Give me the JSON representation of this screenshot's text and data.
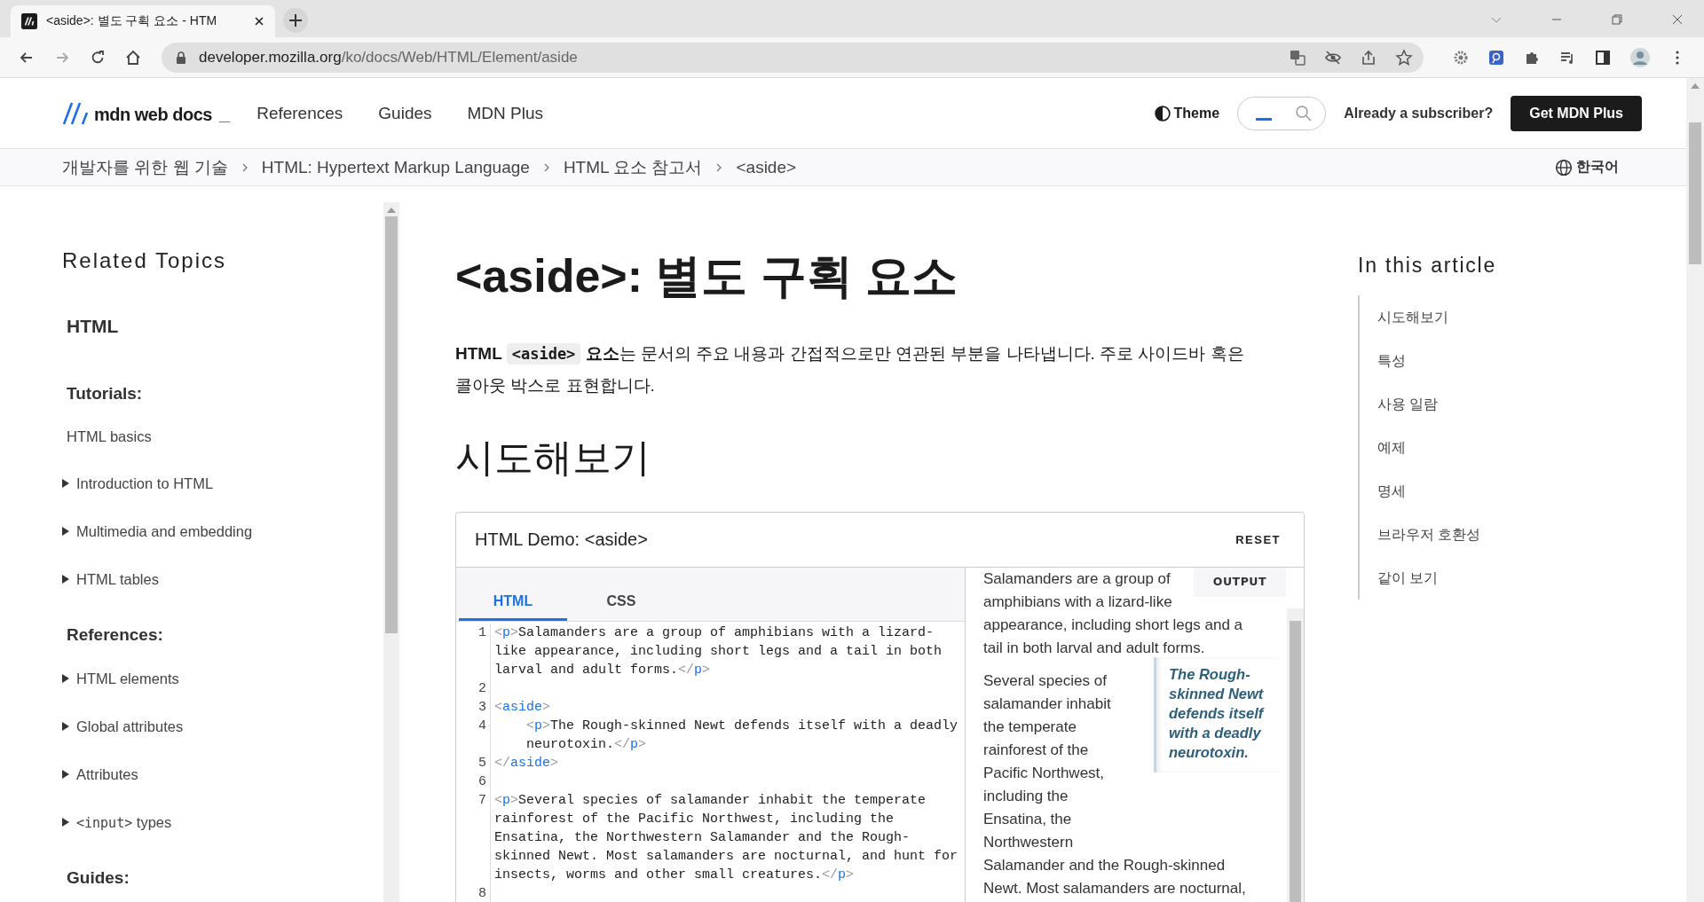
{
  "browser": {
    "tab": {
      "title": "<aside>: 별도 구획 요소 - HTM"
    },
    "address": {
      "host": "developer.mozilla.org",
      "path": "/ko/docs/Web/HTML/Element/aside"
    }
  },
  "header": {
    "logo": "mdn web docs",
    "logo_mark": "_",
    "nav": [
      "References",
      "Guides",
      "MDN Plus"
    ],
    "theme": "Theme",
    "subscriber": "Already a subscriber?",
    "cta": "Get MDN Plus"
  },
  "breadcrumbs": [
    "개발자를 위한 웹 기술",
    "HTML: Hypertext Markup Language",
    "HTML 요소 참고서",
    "<aside>"
  ],
  "language": "한국어",
  "sidebar": {
    "title": "Related Topics",
    "items": [
      {
        "kind": "section",
        "label": "HTML"
      },
      {
        "kind": "heading",
        "label": "Tutorials:"
      },
      {
        "kind": "link",
        "label": "HTML basics"
      },
      {
        "kind": "toggle",
        "label": "Introduction to HTML",
        "expanded": false
      },
      {
        "kind": "toggle",
        "label": "Multimedia and embedding",
        "expanded": false
      },
      {
        "kind": "toggle",
        "label": "HTML tables",
        "expanded": false
      },
      {
        "kind": "heading",
        "label": "References:"
      },
      {
        "kind": "toggle",
        "label": "HTML elements",
        "expanded": false
      },
      {
        "kind": "toggle",
        "label": "Global attributes",
        "expanded": false
      },
      {
        "kind": "toggle",
        "label": "Attributes",
        "expanded": false
      },
      {
        "kind": "toggle",
        "code": "<input>",
        "label": "types",
        "expanded": false
      },
      {
        "kind": "heading",
        "label": "Guides:"
      }
    ]
  },
  "article": {
    "title": "<aside>: 별도 구획 요소",
    "intro": [
      {
        "kind": "strong",
        "text": "HTML "
      },
      {
        "kind": "code",
        "text": "<aside>"
      },
      {
        "kind": "strong",
        "text": " 요소"
      },
      {
        "kind": "plain",
        "text": "는 문서의 주요 내용과 간접적으로만 연관된 부분을 나타냅니다. 주로 사이드바 혹은 콜아웃 박스로 표현합니다."
      }
    ],
    "section_title": "시도해보기"
  },
  "demo": {
    "title": "HTML Demo: <aside>",
    "reset": "RESET",
    "tabs": [
      {
        "label": "HTML",
        "selected": true
      },
      {
        "label": "CSS",
        "selected": false
      }
    ],
    "code_lines": [
      {
        "number": "1",
        "parts": [
          {
            "kind": "punct",
            "text": "<"
          },
          {
            "kind": "tag",
            "text": "p"
          },
          {
            "kind": "punct",
            "text": ">"
          },
          {
            "kind": "text",
            "text": "Salamanders are a group of amphibians with a lizard-like appearance, including short legs and a tail in both larval and adult forms."
          },
          {
            "kind": "punct",
            "text": "</"
          },
          {
            "kind": "tag",
            "text": "p"
          },
          {
            "kind": "punct",
            "text": ">"
          }
        ]
      },
      {
        "number": "2"
      },
      {
        "number": "3",
        "parts": [
          {
            "kind": "punct",
            "text": "<"
          },
          {
            "kind": "tag",
            "text": "aside"
          },
          {
            "kind": "punct",
            "text": ">"
          }
        ]
      },
      {
        "number": "4",
        "indent": true,
        "parts": [
          {
            "kind": "punct",
            "text": "<"
          },
          {
            "kind": "tag",
            "text": "p"
          },
          {
            "kind": "punct",
            "text": ">"
          },
          {
            "kind": "text",
            "text": "The Rough-skinned Newt defends itself with a deadly neurotoxin."
          },
          {
            "kind": "punct",
            "text": "</"
          },
          {
            "kind": "tag",
            "text": "p"
          },
          {
            "kind": "punct",
            "text": ">"
          }
        ]
      },
      {
        "number": "5",
        "parts": [
          {
            "kind": "punct",
            "text": "</"
          },
          {
            "kind": "tag",
            "text": "aside"
          },
          {
            "kind": "punct",
            "text": ">"
          }
        ]
      },
      {
        "number": "6"
      },
      {
        "number": "7",
        "parts": [
          {
            "kind": "punct",
            "text": "<"
          },
          {
            "kind": "tag",
            "text": "p"
          },
          {
            "kind": "punct",
            "text": ">"
          },
          {
            "kind": "text",
            "text": "Several species of salamander inhabit the temperate rainforest of the Pacific Northwest, including the Ensatina, the Northwestern Salamander and the Rough-skinned Newt. Most salamanders are nocturnal, and hunt for insects, worms and other small creatures."
          },
          {
            "kind": "punct",
            "text": "</"
          },
          {
            "kind": "tag",
            "text": "p"
          },
          {
            "kind": "punct",
            "text": ">"
          }
        ]
      },
      {
        "number": "8"
      }
    ],
    "output_label": "OUTPUT",
    "output": {
      "first": [
        "Salamanders are a group of",
        "amphibians with a lizard-like",
        "appearance, including short legs and a",
        "tail in both larval and adult forms."
      ],
      "aside": "The Rough-skinned Newt defends itself with a deadly neurotoxin.",
      "second_beside": [
        "Several species of",
        "salamander inhabit",
        "the temperate",
        "rainforest of the",
        "Pacific Northwest,",
        "including the",
        "Ensatina, the",
        "Northwestern"
      ],
      "second_below": [
        "Salamander and the Rough-skinned",
        "Newt. Most salamanders are nocturnal,"
      ]
    }
  },
  "toc": {
    "title": "In this article",
    "items": [
      "시도해보기",
      "특성",
      "사용 일람",
      "예제",
      "명세",
      "브라우저 호환성",
      "같이 보기"
    ]
  }
}
